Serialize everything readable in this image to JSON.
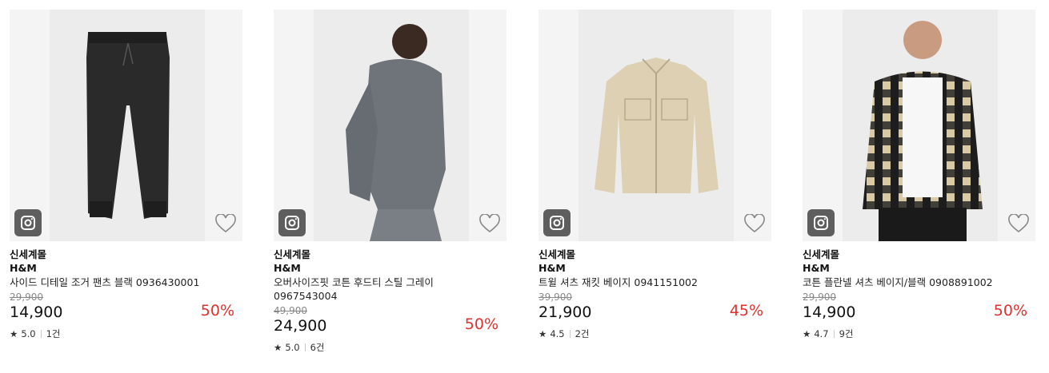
{
  "products": [
    {
      "seller": "신세계몰",
      "brand": "H&M",
      "name": "사이드 디테일 조거 팬츠 블랙 0936430001",
      "original_price": "29,900",
      "price": "14,900",
      "discount": "50%",
      "rating": "5.0",
      "review_count": "1건",
      "image": "black-jogger-pants"
    },
    {
      "seller": "신세계몰",
      "brand": "H&M",
      "name": "오버사이즈핏 코튼 후드티 스틸 그레이 0967543004",
      "original_price": "49,900",
      "price": "24,900",
      "discount": "50%",
      "rating": "5.0",
      "review_count": "6건",
      "image": "model-grey-hoodie"
    },
    {
      "seller": "신세계몰",
      "brand": "H&M",
      "name": "트윌 셔츠 재킷 베이지 0941151002",
      "original_price": "39,900",
      "price": "21,900",
      "discount": "45%",
      "rating": "4.5",
      "review_count": "2건",
      "image": "beige-shirt-jacket"
    },
    {
      "seller": "신세계몰",
      "brand": "H&M",
      "name": "코튼 플란넬 셔츠 베이지/블랙 0908891002",
      "original_price": "29,900",
      "price": "14,900",
      "discount": "50%",
      "rating": "4.7",
      "review_count": "9건",
      "image": "model-beige-black-flannel"
    }
  ],
  "icons": {
    "instagram": "instagram-icon",
    "wishlist": "heart-outline-icon",
    "star": "star-icon"
  },
  "colors": {
    "discount": "#e0312e",
    "icon_bg": "#5e5e5e"
  }
}
